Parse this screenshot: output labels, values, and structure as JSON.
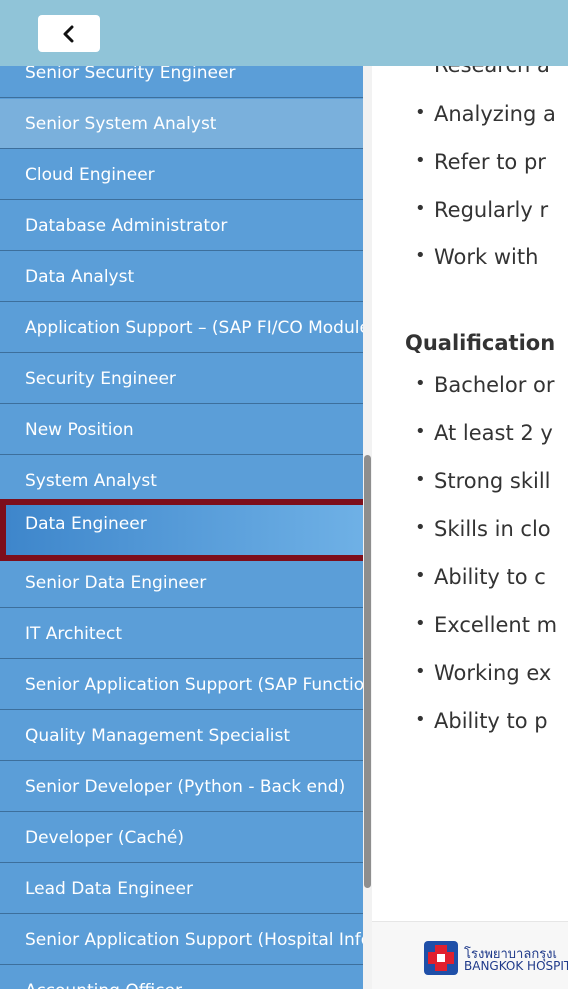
{
  "nav": {
    "back_icon": "chevron-left-icon"
  },
  "menu": {
    "items": [
      {
        "label": "Senior Security Engineer"
      },
      {
        "label": "Senior System Analyst"
      },
      {
        "label": "Cloud Engineer"
      },
      {
        "label": "Database Administrator"
      },
      {
        "label": "Data Analyst"
      },
      {
        "label": "Application Support – (SAP FI/CO Module)"
      },
      {
        "label": "Security Engineer"
      },
      {
        "label": "New Position"
      },
      {
        "label": "System Analyst"
      },
      {
        "label": "Data Engineer"
      },
      {
        "label": "Senior Data Engineer"
      },
      {
        "label": "IT Architect"
      },
      {
        "label": "Senior Application Support (SAP Functional)"
      },
      {
        "label": "Quality Management Specialist"
      },
      {
        "label": "Senior Developer (Python - Back end)"
      },
      {
        "label": "Developer (Caché)"
      },
      {
        "label": "Lead Data Engineer"
      },
      {
        "label": "Senior Application Support (Hospital Informa"
      },
      {
        "label": "Accounting Officer"
      }
    ],
    "selected": "Data Engineer",
    "hovered": "Senior System Analyst"
  },
  "content": {
    "responsibilities_tail": [
      "Research a",
      "Analyzing a",
      "Refer to pr",
      "Regularly r",
      "Work with"
    ],
    "qualification_heading": "Qualification",
    "qualifications": [
      "Bachelor or",
      "At least 2 y",
      "Strong skill",
      "Skills in clo",
      "Ability to c",
      "Excellent m",
      "Working ex",
      "Ability to p"
    ]
  },
  "footer": {
    "logo_thai": "โรงพยาบาลกรุงเ",
    "logo_en": "BANGKOK HOSPIT"
  },
  "colors": {
    "sidebar": "#5b9ed8",
    "selected_border": "#7d0e1b",
    "topbar": "#90c4d8"
  }
}
